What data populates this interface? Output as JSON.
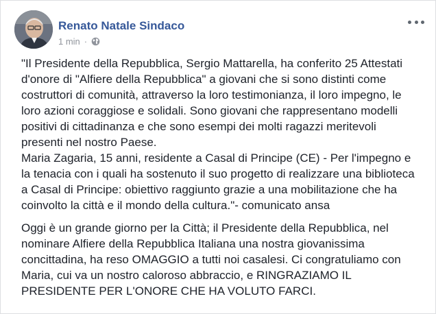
{
  "post": {
    "author": "Renato Natale Sindaco",
    "time": "1 min",
    "separator": "·",
    "privacy_icon": "globe-icon",
    "more_icon": "more-options-icon",
    "paragraph1": "\"Il Presidente della Repubblica, Sergio Mattarella, ha conferito 25 Attestati\nd'onore di \"Alfiere della Repubblica\" a giovani che si sono distinti come\ncostruttori di comunità, attraverso la loro testimonianza, il loro impegno, le\nloro azioni coraggiose e solidali. Sono giovani che rappresentano modelli\npositivi di cittadinanza e che sono esempi dei molti ragazzi meritevoli\npresenti nel nostro Paese.\nMaria Zagaria, 15 anni, residente a Casal di Principe (CE) - Per l'impegno e\nla tenacia con i quali ha sostenuto il suo progetto di realizzare una biblioteca\na Casal di Principe: obiettivo raggiunto grazie a una mobilitazione che ha\ncoinvolto la città e il mondo della cultura.\"- comunicato ansa",
    "paragraph2": "Oggi è un grande giorno per la Città; il Presidente della Repubblica, nel\nnominare Alfiere della Repubblica Italiana una nostra giovanissima\nconcittadina, ha reso OMAGGIO a tutti noi casalesi. Ci congratuliamo con\nMaria, cui va un nostro caloroso abbraccio, e RINGRAZIAMO IL\nPRESIDENTE PER L'ONORE CHE HA VOLUTO FARCI."
  },
  "colors": {
    "author": "#365899",
    "meta": "#90949c",
    "text": "#1d2129",
    "background": "#ffffff"
  }
}
